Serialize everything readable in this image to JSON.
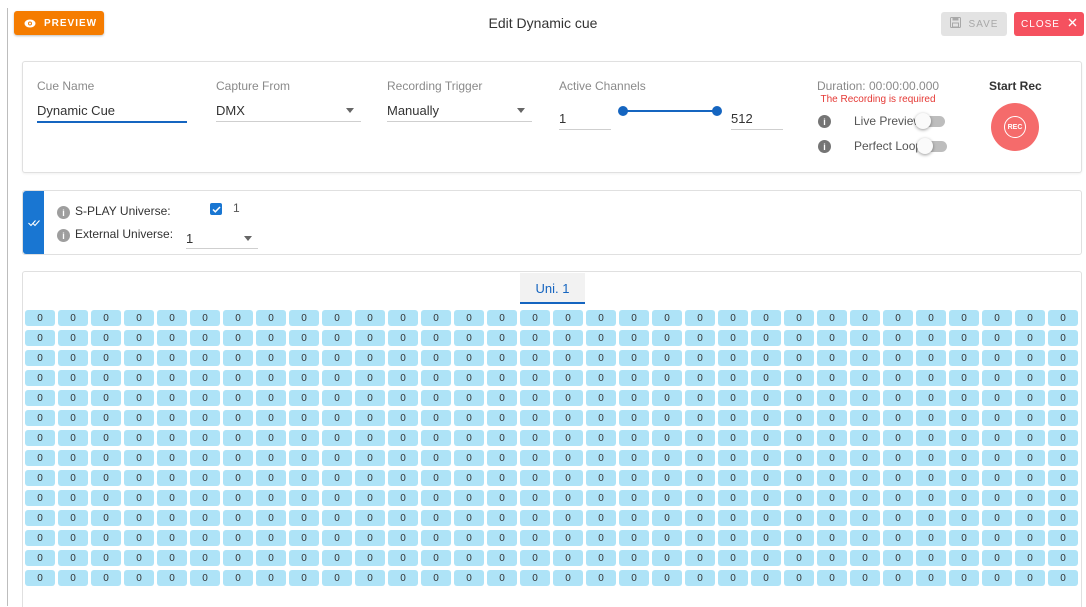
{
  "header": {
    "preview_label": "PREVIEW",
    "title": "Edit Dynamic cue",
    "save_label": "SAVE",
    "close_label": "CLOSE"
  },
  "cue": {
    "name_label": "Cue Name",
    "name_value": "Dynamic Cue",
    "capture_label": "Capture From",
    "capture_value": "DMX",
    "trigger_label": "Recording Trigger",
    "trigger_value": "Manually",
    "channels_label": "Active Channels",
    "channels_min": "1",
    "channels_max": "512",
    "duration_text": "Duration: 00:00:00.000",
    "required_text": "The Recording is required",
    "live_preview_label": "Live Preview",
    "live_preview_on": false,
    "perfect_loop_label": "Perfect Loop",
    "perfect_loop_on": false,
    "start_rec_label": "Start Rec",
    "rec_button_label": "REC"
  },
  "universes": {
    "splay_label": "S-PLAY Universe:",
    "splay_checked": true,
    "splay_value": "1",
    "external_label": "External Universe:",
    "external_value": "1"
  },
  "dmx": {
    "tab_label": "Uni. 1",
    "cell_value": "0",
    "visible_rows": 14,
    "columns": 32
  },
  "colors": {
    "accent": "#1565c0",
    "preview": "#f57c00",
    "close": "#f5515f",
    "rec": "#f56b6b",
    "cell": "#aee3f7"
  }
}
